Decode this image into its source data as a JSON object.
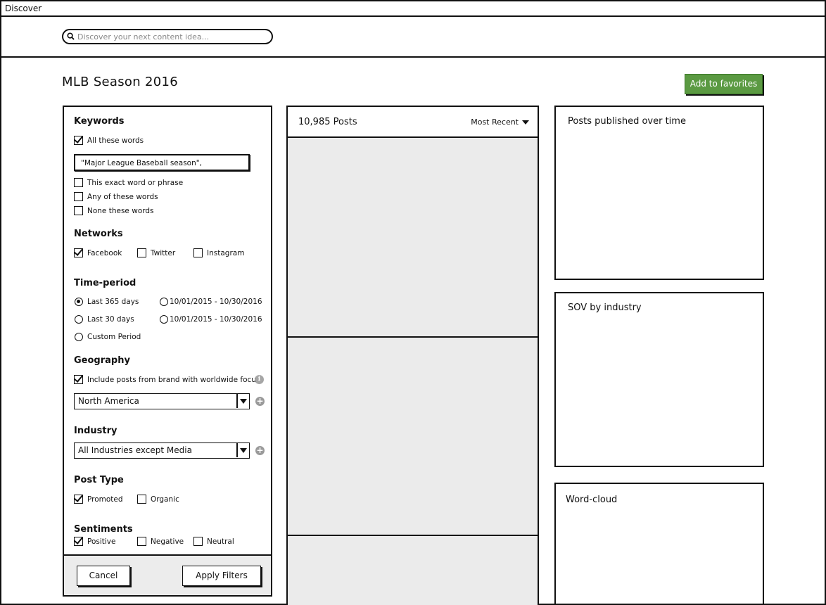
{
  "window": {
    "title": "Discover"
  },
  "search": {
    "placeholder": "Discover your next content idea..."
  },
  "page": {
    "title": "MLB Season 2016",
    "favorites_label": "Add to favorites"
  },
  "filters": {
    "keywords": {
      "heading": "Keywords",
      "all_words": {
        "label": "All these words",
        "checked": true
      },
      "input_value": "\"Major League Baseball season\",",
      "exact": {
        "label": "This exact word or phrase",
        "checked": false
      },
      "any": {
        "label": "Any of these words",
        "checked": false
      },
      "none": {
        "label": "None these words",
        "checked": false
      }
    },
    "networks": {
      "heading": "Networks",
      "facebook": {
        "label": "Facebook",
        "checked": true
      },
      "twitter": {
        "label": "Twitter",
        "checked": false
      },
      "instagram": {
        "label": "Instagram",
        "checked": false
      }
    },
    "time_period": {
      "heading": "Time-period",
      "last365": {
        "label": "Last 365 days",
        "selected": true
      },
      "last30": {
        "label": "Last 30 days",
        "selected": false
      },
      "custom": {
        "label": "Custom Period",
        "selected": false
      },
      "range1": {
        "label": "10/01/2015 - 10/30/2016",
        "selected": false
      },
      "range2": {
        "label": "10/01/2015 - 10/30/2016",
        "selected": false
      }
    },
    "geography": {
      "heading": "Geography",
      "worldwide": {
        "label": "Include posts from brand with worldwide focus",
        "checked": true
      },
      "selected": "North America"
    },
    "industry": {
      "heading": "Industry",
      "selected": "All Industries except Media"
    },
    "post_type": {
      "heading": "Post Type",
      "promoted": {
        "label": "Promoted",
        "checked": true
      },
      "organic": {
        "label": "Organic",
        "checked": false
      }
    },
    "sentiments": {
      "heading": "Sentiments",
      "positive": {
        "label": "Positive",
        "checked": true
      },
      "negative": {
        "label": "Negative",
        "checked": false
      },
      "neutral": {
        "label": "Neutral",
        "checked": false
      }
    },
    "cancel_label": "Cancel",
    "apply_label": "Apply Filters"
  },
  "posts": {
    "count_label": "10,985 Posts",
    "sort_label": "Most Recent"
  },
  "widgets": {
    "over_time": "Posts published over time",
    "sov": "SOV by industry",
    "word_cloud": "Word-cloud"
  },
  "icons": {
    "search": "search-icon",
    "info": "info-icon",
    "plus": "plus-circle-icon",
    "dropdown": "chevron-down-icon"
  },
  "colors": {
    "accent": "#5b9a42",
    "card": "#ebebeb",
    "footer": "#ececec"
  }
}
